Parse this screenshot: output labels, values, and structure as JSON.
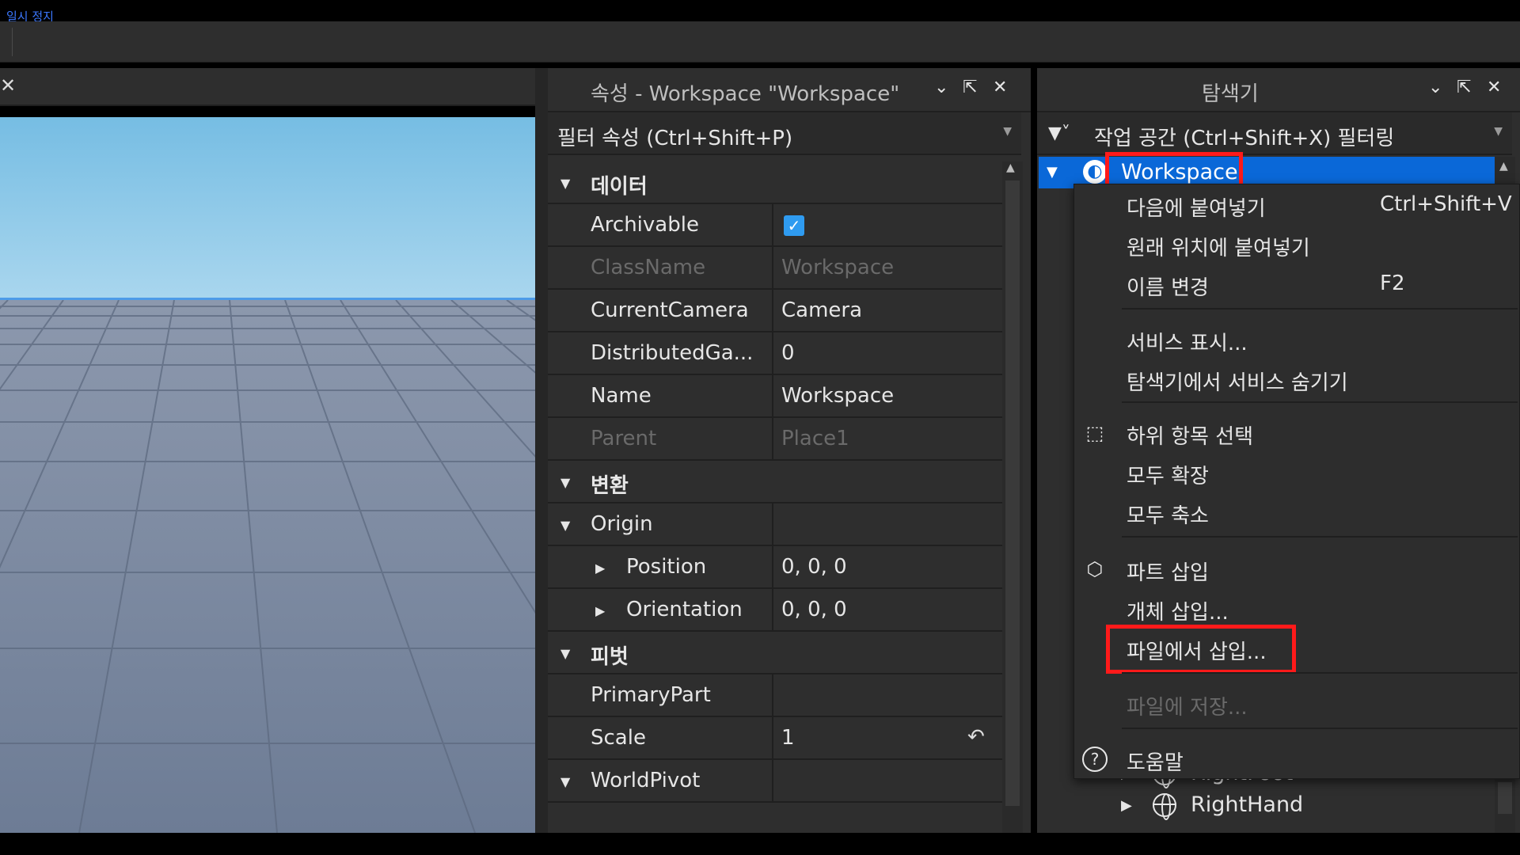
{
  "topbar": {
    "pause_label": "일시 정지"
  },
  "properties": {
    "title": "속성 - Workspace \"Workspace\"",
    "filter_placeholder": "필터 속성 (Ctrl+Shift+P)",
    "sections": {
      "data": "데이터",
      "transform": "변환",
      "pivot": "피벗"
    },
    "rows": {
      "archivable": {
        "name": "Archivable",
        "checked": true
      },
      "classname": {
        "name": "ClassName",
        "value": "Workspace"
      },
      "currentcamera": {
        "name": "CurrentCamera",
        "value": "Camera"
      },
      "distributed": {
        "name": "DistributedGa...",
        "value": "0"
      },
      "name": {
        "name": "Name",
        "value": "Workspace"
      },
      "parent": {
        "name": "Parent",
        "value": "Place1"
      },
      "origin": {
        "name": "Origin",
        "value": ""
      },
      "position": {
        "name": "Position",
        "value": "0, 0, 0"
      },
      "orientation": {
        "name": "Orientation",
        "value": "0, 0, 0"
      },
      "primarypart": {
        "name": "PrimaryPart",
        "value": ""
      },
      "scale": {
        "name": "Scale",
        "value": "1"
      },
      "worldpivot": {
        "name": "WorldPivot",
        "value": ""
      }
    }
  },
  "explorer": {
    "title": "탐색기",
    "filter_placeholder": "작업 공간 (Ctrl+Shift+X) 필터링",
    "selected_item": "Workspace",
    "tree_items": [
      "RightFoot",
      "RightHand"
    ]
  },
  "context_menu": {
    "items": [
      {
        "label": "다음에 붙여넣기",
        "shortcut": "Ctrl+Shift+V"
      },
      {
        "label": "원래 위치에 붙여넣기",
        "shortcut": ""
      },
      {
        "label": "이름 변경",
        "shortcut": "F2"
      },
      {
        "label": "서비스 표시...",
        "shortcut": ""
      },
      {
        "label": "탐색기에서 서비스 숨기기",
        "shortcut": ""
      },
      {
        "label": "하위 항목 선택",
        "shortcut": ""
      },
      {
        "label": "모두 확장",
        "shortcut": ""
      },
      {
        "label": "모두 축소",
        "shortcut": ""
      },
      {
        "label": "파트 삽입",
        "shortcut": ""
      },
      {
        "label": "개체 삽입...",
        "shortcut": ""
      },
      {
        "label": "파일에서 삽입...",
        "shortcut": ""
      },
      {
        "label": "파일에 저장...",
        "shortcut": ""
      },
      {
        "label": "도움말",
        "shortcut": ""
      }
    ]
  },
  "colors": {
    "accent": "#0a68d8",
    "highlight": "#ff1a1a",
    "checkbox": "#2f9bf0"
  }
}
